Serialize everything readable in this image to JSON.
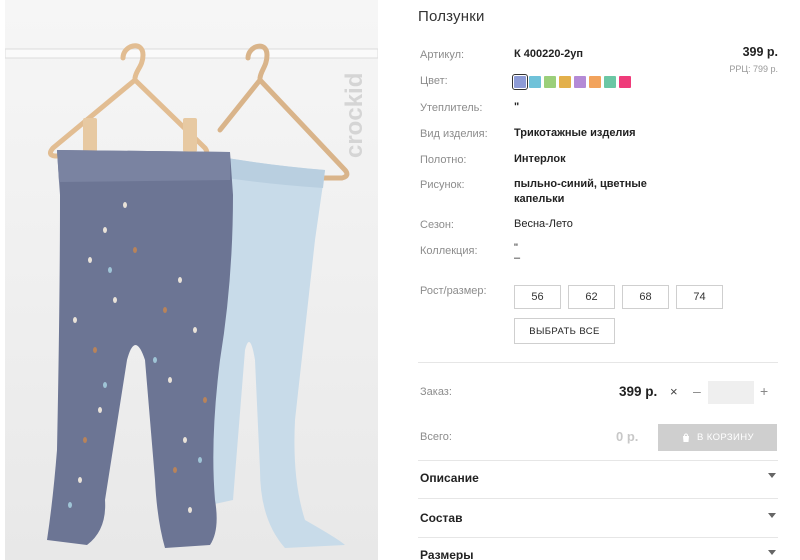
{
  "product": {
    "title": "Ползунки",
    "image_brand": "crockid",
    "price": "399 р.",
    "rrc": "РРЦ: 799 р."
  },
  "specs": {
    "article_label": "Артикул:",
    "article_value": "К 400220-2уп",
    "color_label": "Цвет:",
    "insulation_label": "Утеплитель:",
    "insulation_value": "\"",
    "type_label": "Вид изделия:",
    "type_value": "Трикотажные изделия",
    "fabric_label": "Полотно:",
    "fabric_value": "Интерлок",
    "pattern_label": "Рисунок:",
    "pattern_value_1": "пыльно-синий, цветные",
    "pattern_value_2": "капельки",
    "season_label": "Сезон:",
    "season_value": "Весна-Лето",
    "collection_label": "Коллекция:",
    "collection_value_1": "\"",
    "collection_value_2": "–"
  },
  "swatches": [
    {
      "color": "#8d9bd6",
      "selected": true
    },
    {
      "color": "#6fc2d9"
    },
    {
      "color": "#9bcf7a"
    },
    {
      "color": "#e3b04b"
    },
    {
      "color": "#b48ad6"
    },
    {
      "color": "#f2a35c"
    },
    {
      "color": "#6bc7a4"
    },
    {
      "color": "#ef3b7a"
    }
  ],
  "sizes": {
    "label": "Рост/размер:",
    "options": [
      "56",
      "62",
      "68",
      "74"
    ],
    "select_all": "ВЫБРАТЬ ВСЕ"
  },
  "order": {
    "label": "Заказ:",
    "price": "399 р.",
    "times": "×",
    "minus": "–",
    "plus": "+",
    "quantity": ""
  },
  "total": {
    "label": "Всего:",
    "value": "0 р.",
    "cart_button": "В КОРЗИНУ"
  },
  "accordion": [
    "Описание",
    "Состав",
    "Размеры"
  ],
  "colors": {
    "accent": "#cfcfcf",
    "label": "#8c8c8c",
    "text": "#222222"
  }
}
